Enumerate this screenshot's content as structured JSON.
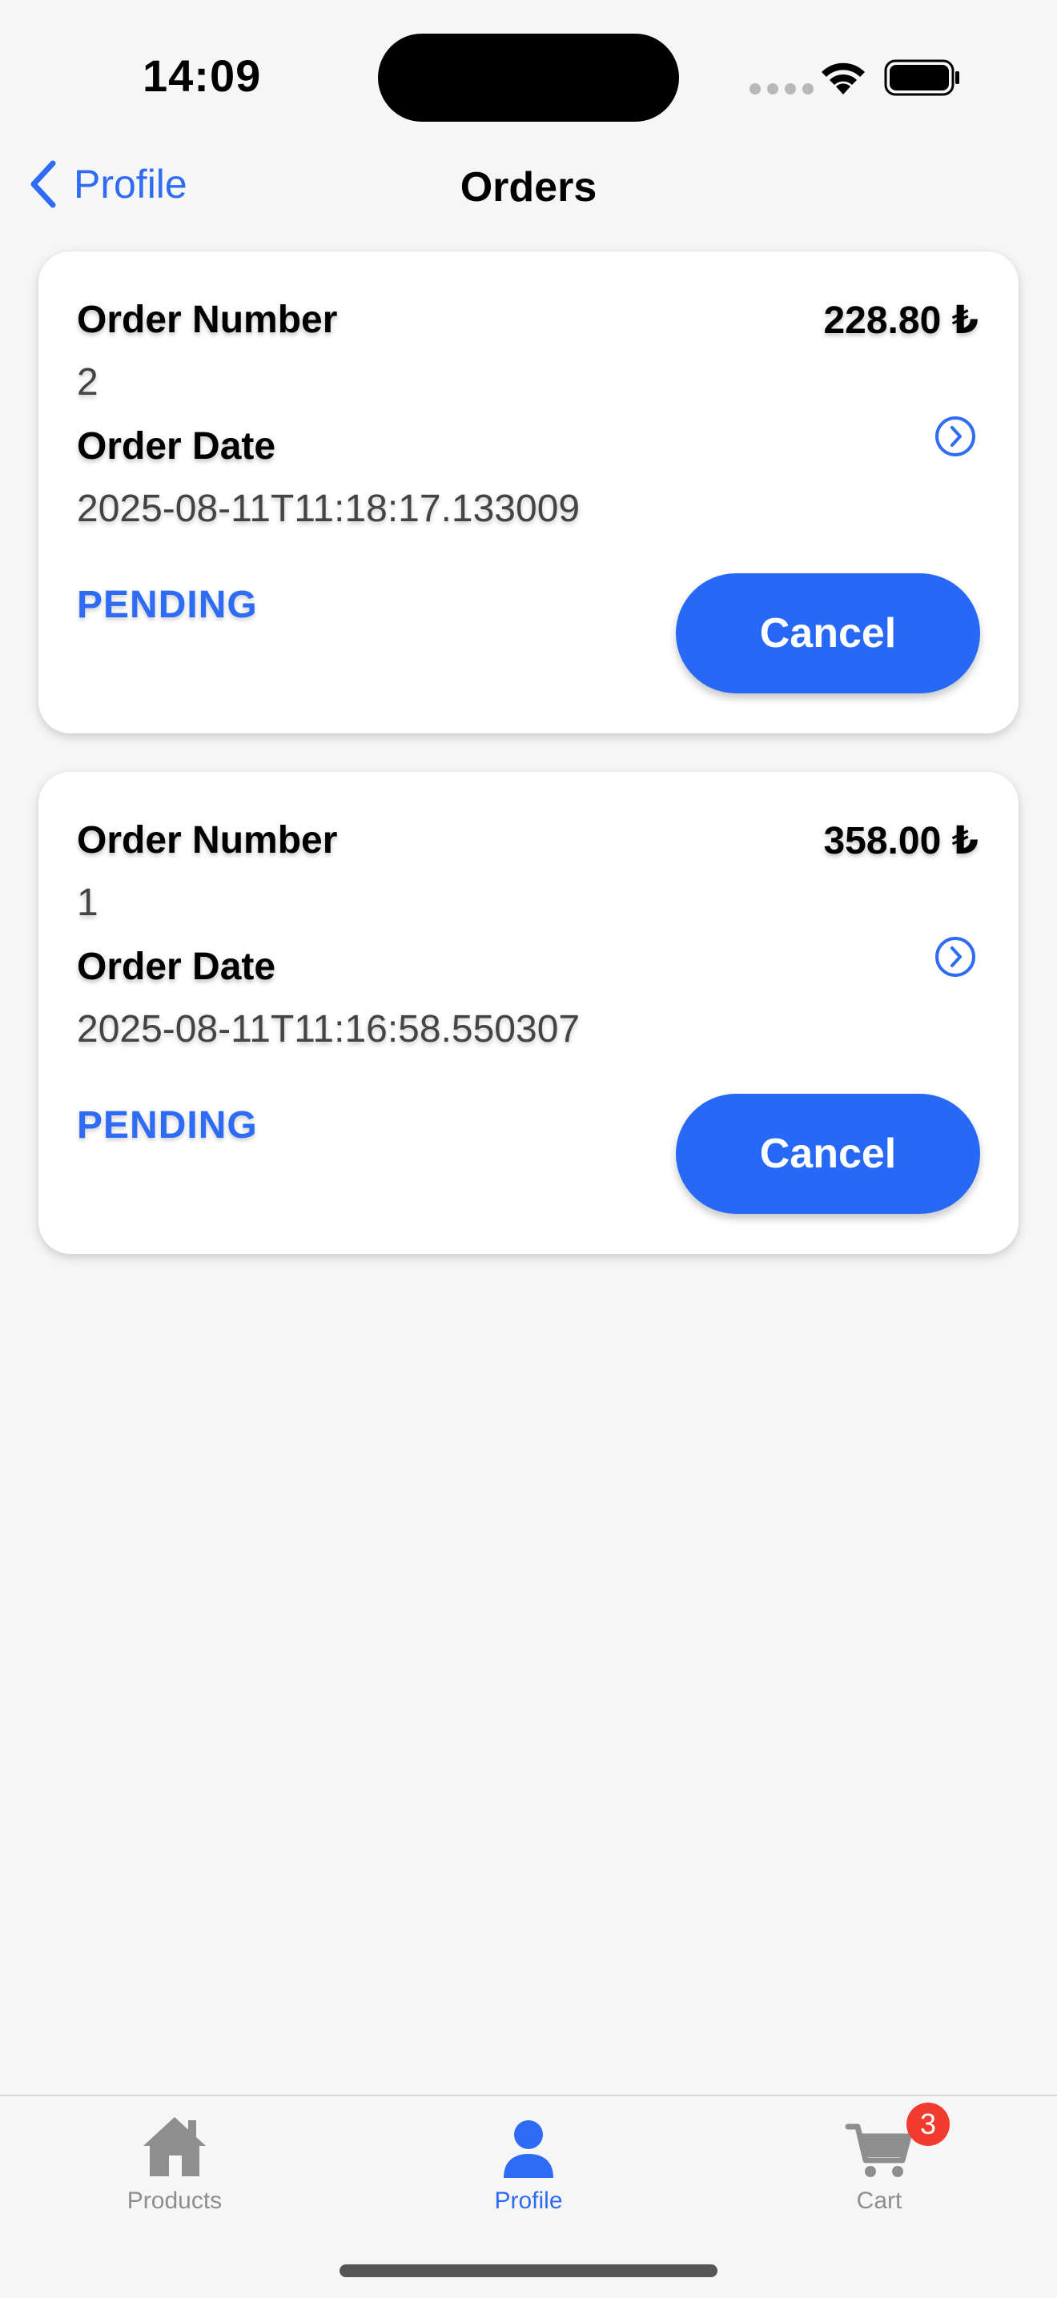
{
  "status_bar": {
    "time": "14:09"
  },
  "nav": {
    "back_label": "Profile",
    "title": "Orders"
  },
  "orders": [
    {
      "number_label": "Order Number",
      "number": "2",
      "date_label": "Order Date",
      "date": "2025-08-11T11:18:17.133009",
      "total": "228.80 ₺",
      "status": "PENDING",
      "cancel_label": "Cancel"
    },
    {
      "number_label": "Order Number",
      "number": "1",
      "date_label": "Order Date",
      "date": "2025-08-11T11:16:58.550307",
      "total": "358.00 ₺",
      "status": "PENDING",
      "cancel_label": "Cancel"
    }
  ],
  "tabbar": {
    "products_label": "Products",
    "profile_label": "Profile",
    "cart_label": "Cart",
    "cart_badge": "3",
    "active_tab": "Profile"
  },
  "colors": {
    "accent": "#2f6cf6",
    "button": "#2769f6",
    "badge": "#f23b2f",
    "background": "#f6f6f6"
  },
  "icons": {
    "back": "chevron-left-icon",
    "detail": "chevron-right-circle-icon",
    "products": "house-icon",
    "profile": "person-icon",
    "cart": "cart-icon",
    "wifi": "wifi-icon",
    "battery": "battery-icon",
    "signal": "signal-icon"
  }
}
